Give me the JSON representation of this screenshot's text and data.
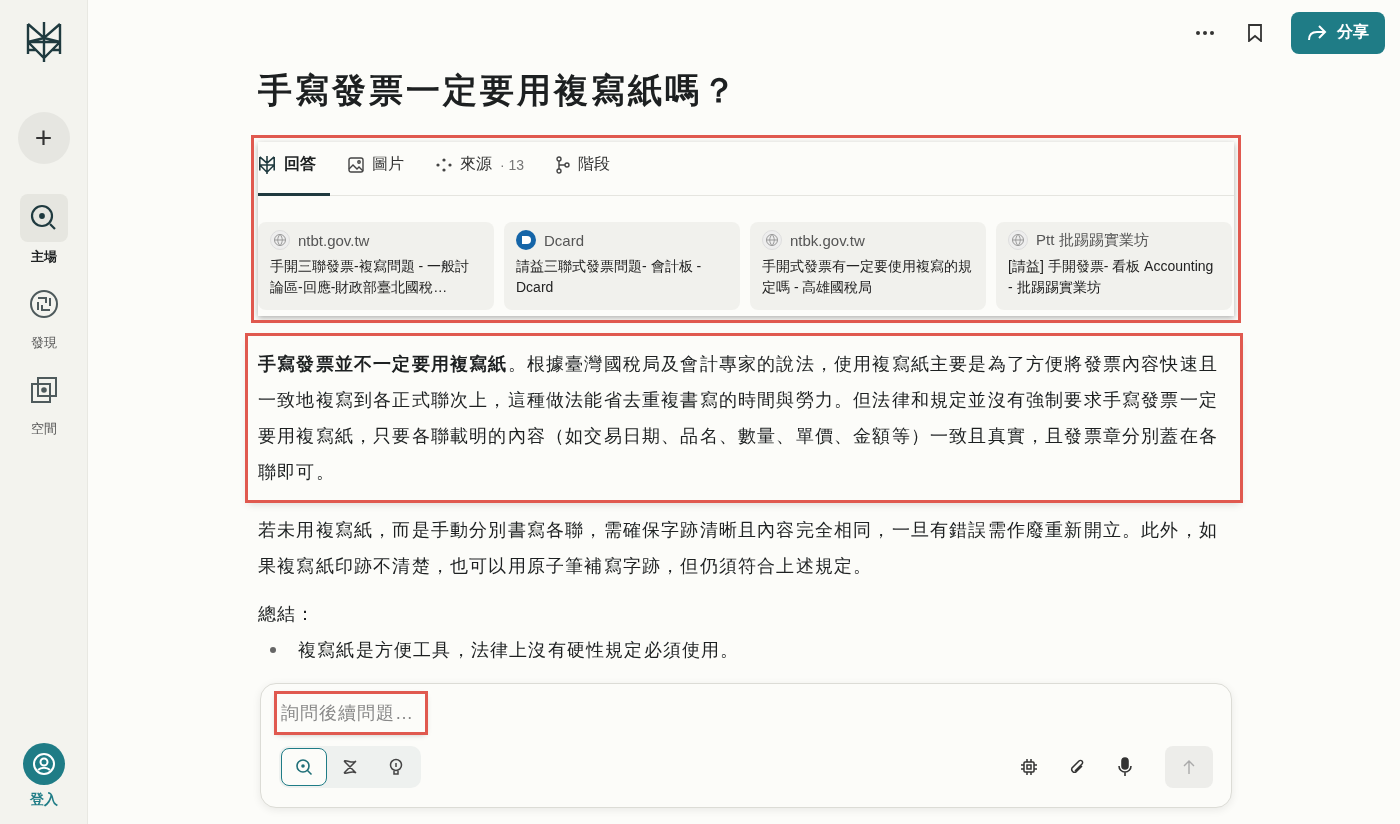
{
  "sidebar": {
    "new_button": "+",
    "items": [
      {
        "label": "主場",
        "selected": true
      },
      {
        "label": "發現",
        "selected": false
      },
      {
        "label": "空間",
        "selected": false
      }
    ],
    "login": "登入"
  },
  "header": {
    "share": "分享"
  },
  "title": "手寫發票一定要用複寫紙嗎？",
  "tabs": [
    {
      "label": "回答",
      "selected": true
    },
    {
      "label": "圖片",
      "selected": false
    },
    {
      "label": "來源",
      "count": "· 13",
      "selected": false
    },
    {
      "label": "階段",
      "selected": false
    }
  ],
  "sources": {
    "highlighted": true,
    "items": [
      {
        "site": "ntbt.gov.tw",
        "title": "手開三聯發票-複寫問題 - 一般討論區-回應-財政部臺北國稅…"
      },
      {
        "site": "Dcard",
        "title": "請益三聯式發票問題- 會計板 - Dcard"
      },
      {
        "site": "ntbk.gov.tw",
        "title": "手開式發票有一定要使用複寫的規定嗎 - 高雄國稅局"
      },
      {
        "site": "Ptt 批踢踢實業坊",
        "title": "[請益] 手開發票- 看板 Accounting - 批踢踢實業坊"
      }
    ]
  },
  "summary": {
    "highlighted": true,
    "text": "**手寫發票並不一定要用複寫紙**。根據臺灣國稅局及會計專家的說法，使用複寫紙主要是為了方便將發票內容快速且一致地複寫到各正式聯次上，這種做法能省去重複書寫的時間與勞力。但法律和規定並沒有強制要求手寫發票一定要用複寫紙，只要各聯載明的內容（如交易日期、品名、數量、單價、金額等）一致且真實，且發票章分別蓋在各聯即可。"
  },
  "answer": [
    {
      "kind": "paragraph",
      "text": "若未用複寫紙，而是手動分別書寫各聯，需確保字跡清晰且內容完全相同，一旦有錯誤需作廢重新開立。此外，如果複寫紙印跡不清楚，也可以用原子筆補寫字跡，但仍須符合上述規定。"
    },
    {
      "kind": "heading",
      "text": "總結："
    },
    {
      "kind": "bullet",
      "text": "複寫紙是方便工具，法律上沒有硬性規定必須使用。"
    }
  ],
  "composer": {
    "placeholder": "詢問後續問題…",
    "highlighted": true,
    "modes": [
      {
        "selected": true
      },
      {
        "selected": false
      },
      {
        "selected": false
      }
    ],
    "send_disabled": true
  }
}
